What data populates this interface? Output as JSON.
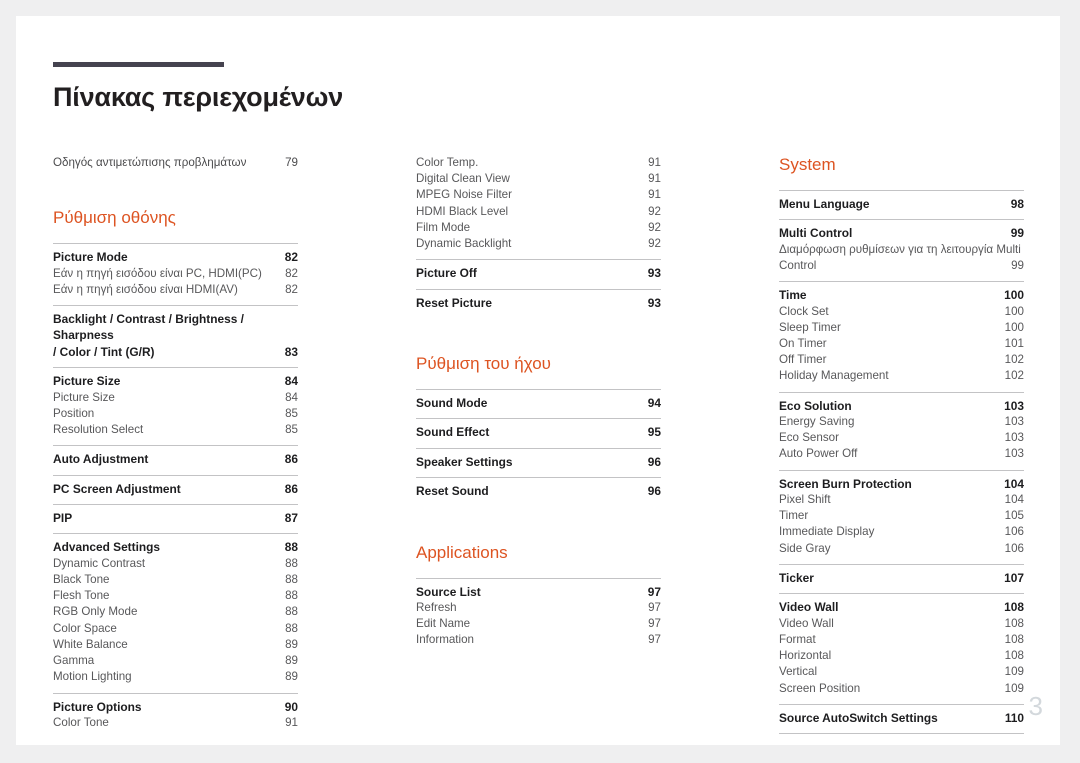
{
  "document": {
    "title": "Πίνακας περιεχομένων",
    "page_number": "3",
    "accent_color": "#dd5422",
    "rule_color": "#45434f"
  },
  "columns": [
    {
      "blocks": [
        {
          "type": "plain",
          "rows": [
            {
              "label": "Οδηγός αντιμετώπισης προβλημάτων",
              "page": "79"
            }
          ]
        },
        {
          "type": "section",
          "heading": "Ρύθμιση οθόνης",
          "groups": [
            {
              "head": {
                "label": "Picture Mode",
                "page": "82"
              },
              "subs": [
                {
                  "label": "Εάν η πηγή εισόδου είναι PC, HDMI(PC)",
                  "page": "82"
                },
                {
                  "label": "Εάν η πηγή εισόδου είναι HDMI(AV)",
                  "page": "82"
                }
              ]
            },
            {
              "head": {
                "label_line1": "Backlight / Contrast / Brightness / Sharpness",
                "label_line2": "/ Color / Tint (G/R)",
                "page": "83",
                "wrapped": true
              },
              "subs": []
            },
            {
              "head": {
                "label": "Picture Size",
                "page": "84"
              },
              "subs": [
                {
                  "label": "Picture Size",
                  "page": "84"
                },
                {
                  "label": "Position",
                  "page": "85"
                },
                {
                  "label": "Resolution Select",
                  "page": "85"
                }
              ]
            },
            {
              "head": {
                "label": "Auto Adjustment",
                "page": "86"
              },
              "subs": []
            },
            {
              "head": {
                "label": "PC Screen Adjustment",
                "page": "86"
              },
              "subs": []
            },
            {
              "head": {
                "label": "PIP",
                "page": "87"
              },
              "subs": []
            },
            {
              "head": {
                "label": "Advanced Settings",
                "page": "88"
              },
              "subs": [
                {
                  "label": "Dynamic Contrast",
                  "page": "88"
                },
                {
                  "label": "Black Tone",
                  "page": "88"
                },
                {
                  "label": "Flesh Tone",
                  "page": "88"
                },
                {
                  "label": "RGB Only Mode",
                  "page": "88"
                },
                {
                  "label": "Color Space",
                  "page": "88"
                },
                {
                  "label": "White Balance",
                  "page": "89"
                },
                {
                  "label": "Gamma",
                  "page": "89"
                },
                {
                  "label": "Motion Lighting",
                  "page": "89"
                }
              ]
            },
            {
              "head": {
                "label": "Picture Options",
                "page": "90"
              },
              "subs": [
                {
                  "label": "Color Tone",
                  "page": "91"
                }
              ]
            }
          ]
        }
      ]
    },
    {
      "blocks": [
        {
          "type": "continuation",
          "subs": [
            {
              "label": "Color Temp.",
              "page": "91"
            },
            {
              "label": "Digital Clean View",
              "page": "91"
            },
            {
              "label": "MPEG Noise Filter",
              "page": "91"
            },
            {
              "label": "HDMI Black Level",
              "page": "92"
            },
            {
              "label": "Film Mode",
              "page": "92"
            },
            {
              "label": "Dynamic Backlight",
              "page": "92"
            }
          ],
          "groups": [
            {
              "head": {
                "label": "Picture Off",
                "page": "93"
              },
              "subs": []
            },
            {
              "head": {
                "label": "Reset Picture",
                "page": "93"
              },
              "subs": []
            }
          ]
        },
        {
          "type": "section",
          "heading": "Ρύθμιση του ήχου",
          "groups": [
            {
              "head": {
                "label": "Sound Mode",
                "page": "94"
              },
              "subs": []
            },
            {
              "head": {
                "label": "Sound Effect",
                "page": "95"
              },
              "subs": []
            },
            {
              "head": {
                "label": "Speaker Settings",
                "page": "96"
              },
              "subs": []
            },
            {
              "head": {
                "label": "Reset Sound",
                "page": "96"
              },
              "subs": []
            }
          ]
        },
        {
          "type": "section",
          "heading": "Applications",
          "groups": [
            {
              "head": {
                "label": "Source List",
                "page": "97"
              },
              "subs": [
                {
                  "label": "Refresh",
                  "page": "97"
                },
                {
                  "label": "Edit Name",
                  "page": "97"
                },
                {
                  "label": "Information",
                  "page": "97"
                }
              ]
            }
          ]
        }
      ]
    },
    {
      "blocks": [
        {
          "type": "section",
          "heading": "System",
          "groups": [
            {
              "head": {
                "label": "Menu Language",
                "page": "98"
              },
              "subs": []
            },
            {
              "head": {
                "label": "Multi Control",
                "page": "99"
              },
              "subs": [
                {
                  "label_line1": "Διαμόρφωση ρυθμίσεων για τη λειτουργία Multi",
                  "label_line2": "Control",
                  "page": "99",
                  "wrapped": true
                }
              ]
            },
            {
              "head": {
                "label": "Time",
                "page": "100"
              },
              "subs": [
                {
                  "label": "Clock Set",
                  "page": "100"
                },
                {
                  "label": "Sleep Timer",
                  "page": "100"
                },
                {
                  "label": "On Timer",
                  "page": "101"
                },
                {
                  "label": "Off Timer",
                  "page": "102"
                },
                {
                  "label": "Holiday Management",
                  "page": "102"
                }
              ]
            },
            {
              "head": {
                "label": "Eco Solution",
                "page": "103"
              },
              "subs": [
                {
                  "label": "Energy Saving",
                  "page": "103"
                },
                {
                  "label": "Eco Sensor",
                  "page": "103"
                },
                {
                  "label": "Auto Power Off",
                  "page": "103"
                }
              ]
            },
            {
              "head": {
                "label": "Screen Burn Protection",
                "page": "104"
              },
              "subs": [
                {
                  "label": "Pixel Shift",
                  "page": "104"
                },
                {
                  "label": "Timer",
                  "page": "105"
                },
                {
                  "label": "Immediate Display",
                  "page": "106"
                },
                {
                  "label": "Side Gray",
                  "page": "106"
                }
              ]
            },
            {
              "head": {
                "label": "Ticker",
                "page": "107"
              },
              "subs": []
            },
            {
              "head": {
                "label": "Video Wall",
                "page": "108"
              },
              "subs": [
                {
                  "label": "Video Wall",
                  "page": "108"
                },
                {
                  "label": "Format",
                  "page": "108"
                },
                {
                  "label": "Horizontal",
                  "page": "108"
                },
                {
                  "label": "Vertical",
                  "page": "109"
                },
                {
                  "label": "Screen Position",
                  "page": "109"
                }
              ]
            },
            {
              "head": {
                "label": "Source AutoSwitch Settings",
                "page": "110"
              },
              "subs": [],
              "last": true
            }
          ]
        }
      ]
    }
  ]
}
